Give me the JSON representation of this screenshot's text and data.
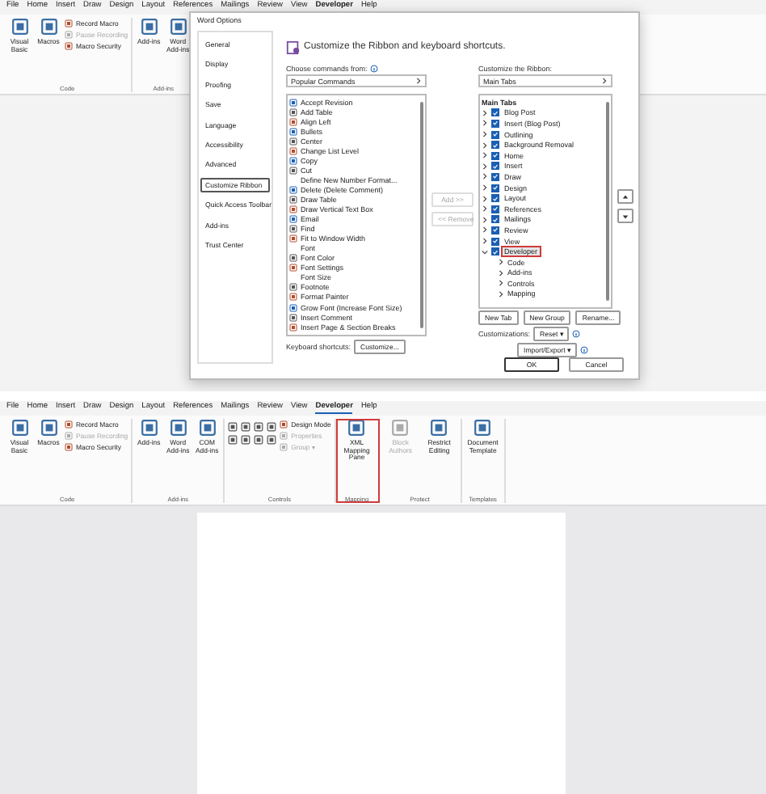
{
  "top": {
    "menu": [
      {
        "label": "File",
        "selected": false
      },
      {
        "label": "Home",
        "selected": false
      },
      {
        "label": "Insert",
        "selected": false
      },
      {
        "label": "Draw",
        "selected": false
      },
      {
        "label": "Design",
        "selected": false
      },
      {
        "label": "Layout",
        "selected": false
      },
      {
        "label": "References",
        "selected": false
      },
      {
        "label": "Mailings",
        "selected": false
      },
      {
        "label": "Review",
        "selected": false
      },
      {
        "label": "View",
        "selected": false
      },
      {
        "label": "Developer",
        "selected": true
      },
      {
        "label": "Help",
        "selected": false
      }
    ],
    "ribbon": [
      {
        "label": "Code",
        "highlighted": false,
        "controls": [
          {
            "kind": "large",
            "label": "Visual Basic",
            "disabled": false
          },
          {
            "kind": "large",
            "label": "Macros",
            "disabled": false
          },
          {
            "kind": "small",
            "label": "Record Macro",
            "disabled": false
          },
          {
            "kind": "small",
            "label": "Pause Recording",
            "disabled": true
          },
          {
            "kind": "small",
            "label": "Macro Security",
            "disabled": false
          }
        ]
      },
      {
        "label": "Add-ins",
        "highlighted": false,
        "controls": [
          {
            "kind": "large",
            "label": "Add-ins",
            "disabled": false
          },
          {
            "kind": "large",
            "label": "Word Add-ins",
            "disabled": false
          }
        ]
      }
    ]
  },
  "dialog": {
    "title": "Word Options",
    "sidebar": [
      {
        "label": "General",
        "selected": false
      },
      {
        "label": "Display",
        "selected": false
      },
      {
        "label": "Proofing",
        "selected": false
      },
      {
        "label": "Save",
        "selected": false
      },
      {
        "label": "Language",
        "selected": false
      },
      {
        "label": "Accessibility",
        "selected": false
      },
      {
        "label": "Advanced",
        "selected": false
      },
      {
        "label": "Customize Ribbon",
        "selected": true
      },
      {
        "label": "Quick Access Toolbar",
        "selected": false
      },
      {
        "label": "Add-ins",
        "selected": false
      },
      {
        "label": "Trust Center",
        "selected": false
      }
    ],
    "heading": "Customize the Ribbon and keyboard shortcuts.",
    "commands_label": "Choose commands from:",
    "commands_source": "Popular Commands",
    "commands": [
      {
        "label": "Accept Revision",
        "icon": true
      },
      {
        "label": "Add Table",
        "icon": true
      },
      {
        "label": "Align Left",
        "icon": true
      },
      {
        "label": "Bullets",
        "icon": true
      },
      {
        "label": "Center",
        "icon": true
      },
      {
        "label": "Change List Level",
        "icon": true
      },
      {
        "label": "Copy",
        "icon": true
      },
      {
        "label": "Cut",
        "icon": true
      },
      {
        "label": "Define New Number Format...",
        "icon": false
      },
      {
        "label": "Delete (Delete Comment)",
        "icon": true
      },
      {
        "label": "Draw Table",
        "icon": true
      },
      {
        "label": "Draw Vertical Text Box",
        "icon": true
      },
      {
        "label": "Email",
        "icon": true
      },
      {
        "label": "Find",
        "icon": true
      },
      {
        "label": "Fit to Window Width",
        "icon": true
      },
      {
        "label": "Font",
        "icon": false
      },
      {
        "label": "Font Color",
        "icon": true
      },
      {
        "label": "Font Settings",
        "icon": true
      },
      {
        "label": "Font Size",
        "icon": false
      },
      {
        "label": "Footnote",
        "icon": true
      },
      {
        "label": "Format Painter",
        "icon": true
      },
      {
        "label": "Grow Font (Increase Font Size)",
        "icon": true
      },
      {
        "label": "Insert Comment",
        "icon": true
      },
      {
        "label": "Insert Page & Section Breaks",
        "icon": true
      }
    ],
    "add_button": {
      "label": "Add >>",
      "disabled": true
    },
    "remove_button": {
      "label": "<< Remove",
      "disabled": true
    },
    "shortcuts_label": "Keyboard shortcuts:",
    "customize_button": "Customize...",
    "ribbon_label": "Customize the Ribbon:",
    "ribbon_source": "Main Tabs",
    "tree_heading": "Main Tabs",
    "tabs": [
      {
        "label": "Blog Post",
        "checked": true,
        "expanded": false,
        "selected": false
      },
      {
        "label": "Insert (Blog Post)",
        "checked": true,
        "expanded": false,
        "selected": false
      },
      {
        "label": "Outlining",
        "checked": true,
        "expanded": false,
        "selected": false
      },
      {
        "label": "Background Removal",
        "checked": true,
        "expanded": false,
        "selected": false
      },
      {
        "label": "Home",
        "checked": true,
        "expanded": false,
        "selected": false
      },
      {
        "label": "Insert",
        "checked": true,
        "expanded": false,
        "selected": false
      },
      {
        "label": "Draw",
        "checked": true,
        "expanded": false,
        "selected": false
      },
      {
        "label": "Design",
        "checked": true,
        "expanded": false,
        "selected": false
      },
      {
        "label": "Layout",
        "checked": true,
        "expanded": false,
        "selected": false
      },
      {
        "label": "References",
        "checked": true,
        "expanded": false,
        "selected": false
      },
      {
        "label": "Mailings",
        "checked": true,
        "expanded": false,
        "selected": false
      },
      {
        "label": "Review",
        "checked": true,
        "expanded": false,
        "selected": false
      },
      {
        "label": "View",
        "checked": true,
        "expanded": false,
        "selected": false
      },
      {
        "label": "Developer",
        "checked": true,
        "expanded": true,
        "selected": true,
        "children": [
          {
            "label": "Code",
            "expanded": false
          },
          {
            "label": "Add-ins",
            "expanded": false
          },
          {
            "label": "Controls",
            "expanded": false
          },
          {
            "label": "Mapping",
            "expanded": false
          }
        ]
      }
    ],
    "tab_buttons": [
      "New Tab",
      "New Group",
      "Rename..."
    ],
    "customizations_label": "Customizations:",
    "reset_button": "Reset ▾",
    "import_export_button": "Import/Export ▾",
    "ok_button": "OK",
    "cancel_button": "Cancel"
  },
  "bottom": {
    "menu": [
      {
        "label": "File",
        "selected": false
      },
      {
        "label": "Home",
        "selected": false
      },
      {
        "label": "Insert",
        "selected": false
      },
      {
        "label": "Draw",
        "selected": false
      },
      {
        "label": "Design",
        "selected": false
      },
      {
        "label": "Layout",
        "selected": false
      },
      {
        "label": "References",
        "selected": false
      },
      {
        "label": "Mailings",
        "selected": false
      },
      {
        "label": "Review",
        "selected": false
      },
      {
        "label": "View",
        "selected": false
      },
      {
        "label": "Developer",
        "selected": true
      },
      {
        "label": "Help",
        "selected": false
      }
    ],
    "ribbon": [
      {
        "label": "Code",
        "highlighted": false,
        "controls": [
          {
            "kind": "large",
            "label": "Visual Basic",
            "disabled": false
          },
          {
            "kind": "large",
            "label": "Macros",
            "disabled": false
          },
          {
            "kind": "small",
            "label": "Record Macro",
            "disabled": false
          },
          {
            "kind": "small",
            "label": "Pause Recording",
            "disabled": true
          },
          {
            "kind": "small",
            "label": "Macro Security",
            "disabled": false
          }
        ]
      },
      {
        "label": "Add-ins",
        "highlighted": false,
        "controls": [
          {
            "kind": "large",
            "label": "Add-ins",
            "disabled": false
          },
          {
            "kind": "large",
            "label": "Word Add-ins",
            "disabled": false
          },
          {
            "kind": "large",
            "label": "COM Add-ins",
            "disabled": false
          }
        ]
      },
      {
        "label": "Controls",
        "highlighted": false,
        "controls": [
          {
            "kind": "grid"
          },
          {
            "kind": "small",
            "label": "Design Mode",
            "disabled": false
          },
          {
            "kind": "small",
            "label": "Properties",
            "disabled": true
          },
          {
            "kind": "small",
            "label": "Group ▾",
            "disabled": true
          }
        ]
      },
      {
        "label": "Mapping",
        "highlighted": true,
        "controls": [
          {
            "kind": "large",
            "label": "XML Mapping Pane",
            "disabled": false
          }
        ]
      },
      {
        "label": "Protect",
        "highlighted": false,
        "controls": [
          {
            "kind": "large",
            "label": "Block Authors",
            "disabled": true
          },
          {
            "kind": "large",
            "label": "Restrict Editing",
            "disabled": false
          }
        ]
      },
      {
        "label": "Templates",
        "highlighted": false,
        "controls": [
          {
            "kind": "large",
            "label": "Document Template",
            "disabled": false
          }
        ]
      }
    ]
  }
}
